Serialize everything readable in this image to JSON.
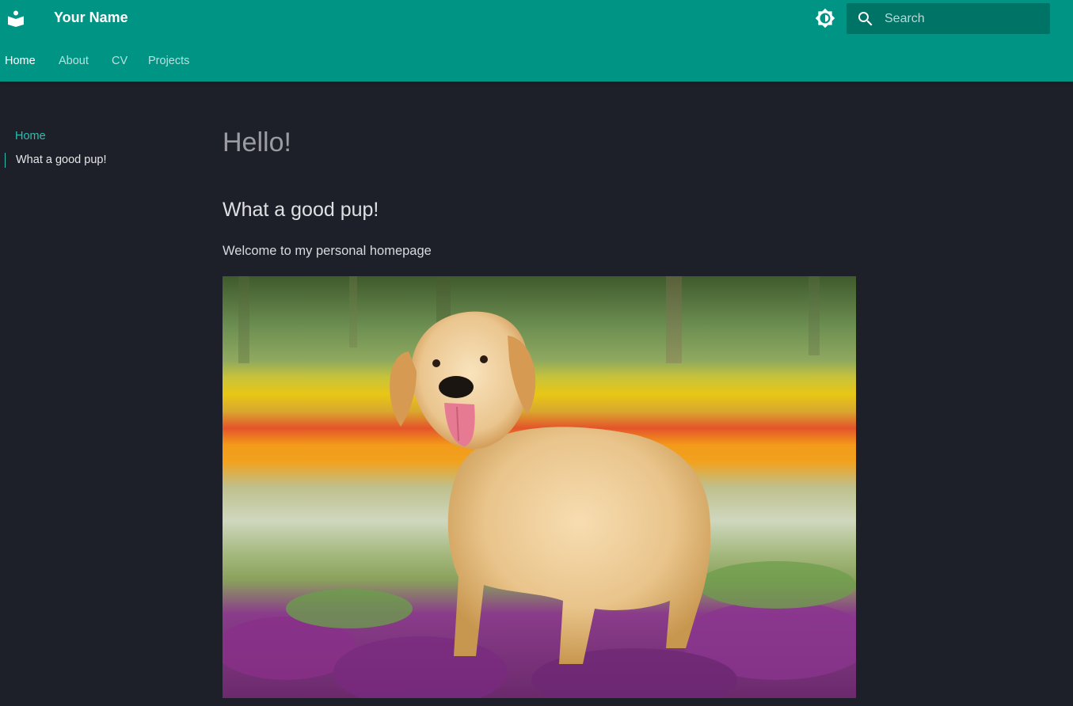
{
  "header": {
    "site_title": "Your Name",
    "logo_icon": "book-reader-icon",
    "theme_toggle_icon": "brightness-icon",
    "search": {
      "placeholder": "Search",
      "icon": "search-icon"
    },
    "tabs": [
      {
        "label": "Home",
        "active": true
      },
      {
        "label": "About",
        "active": false
      },
      {
        "label": "CV",
        "active": false
      },
      {
        "label": "Projects",
        "active": false
      }
    ]
  },
  "sidebar": {
    "title": "Home",
    "toc": [
      {
        "label": "What a good pup!"
      }
    ]
  },
  "main": {
    "heading": "Hello!",
    "subheading": "What a good pup!",
    "paragraph": "Welcome to my personal homepage",
    "image": {
      "subject": "golden retriever standing in a field of flowers"
    }
  },
  "colors": {
    "primary": "#009485",
    "accent": "#2bbfb0",
    "background": "#1e2029"
  }
}
